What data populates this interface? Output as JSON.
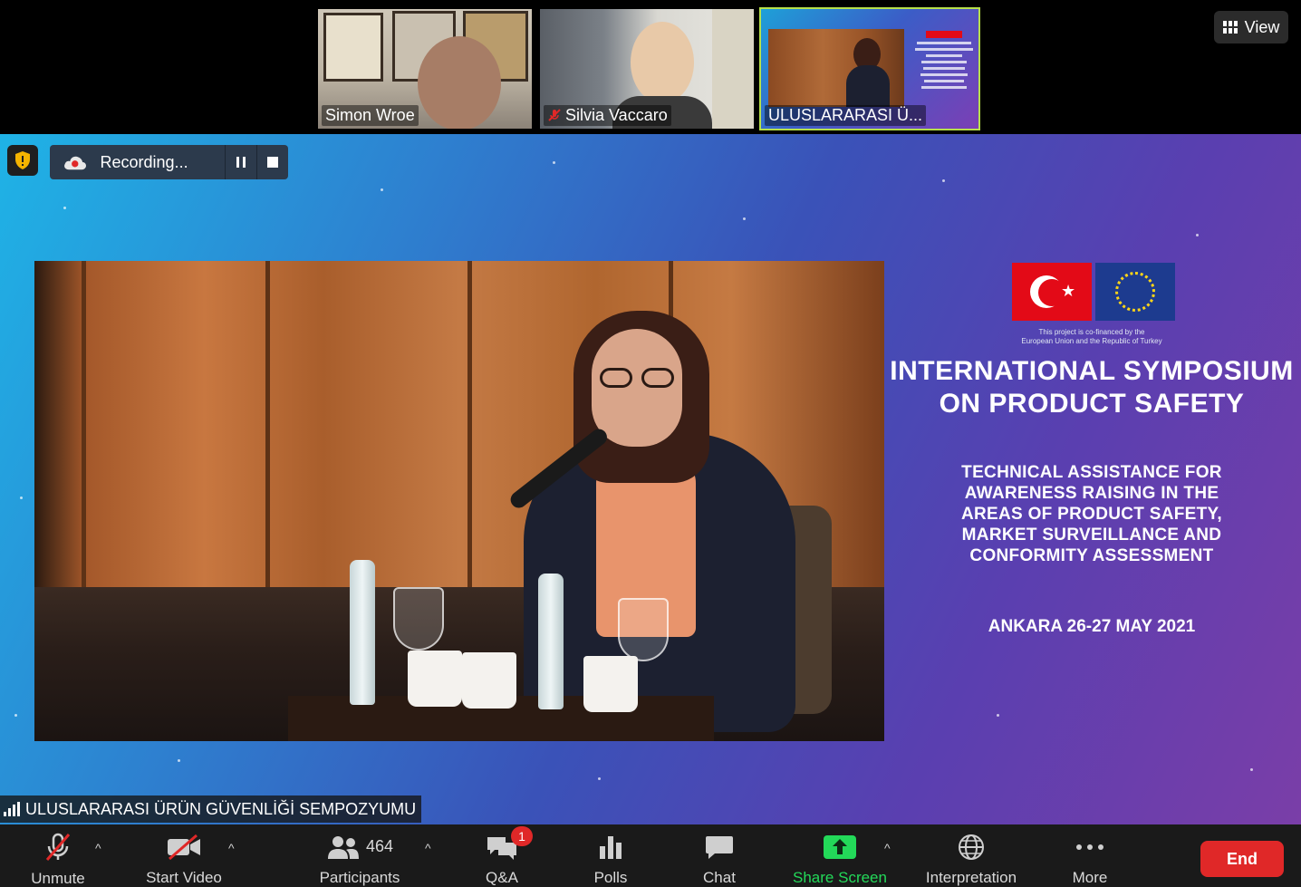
{
  "top_strip": {
    "thumbnails": [
      {
        "name": "Simon Wroe",
        "muted": false
      },
      {
        "name": "Silvia Vaccaro",
        "muted": true
      },
      {
        "name": "ULUSLARARASI Ü...",
        "muted": false
      }
    ],
    "view_label": "View"
  },
  "recording": {
    "label": "Recording..."
  },
  "slide": {
    "cofinance_line1": "This project is co-financed by the",
    "cofinance_line2": "European Union and the Republic of Turkey",
    "title": "INTERNATIONAL SYMPOSIUM ON PRODUCT SAFETY",
    "subtitle": "TECHNICAL ASSISTANCE FOR AWARENESS RAISING IN THE AREAS OF PRODUCT SAFETY, MARKET SURVEILLANCE AND CONFORMITY ASSESSMENT",
    "date": "ANKARA 26-27 MAY 2021"
  },
  "stage_name": "ULUSLARARASI ÜRÜN GÜVENLİĞİ SEMPOZYUMU",
  "toolbar": {
    "unmute": "Unmute",
    "start_video": "Start Video",
    "participants": "Participants",
    "participant_count": "464",
    "qa": "Q&A",
    "qa_badge": "1",
    "polls": "Polls",
    "chat": "Chat",
    "share_screen": "Share Screen",
    "interpretation": "Interpretation",
    "more": "More",
    "end": "End"
  },
  "colors": {
    "active_speaker_border": "#b7e04a",
    "share_green": "#23d959",
    "end_red": "#e02828",
    "toolbar_bg": "#1a1a1a"
  }
}
